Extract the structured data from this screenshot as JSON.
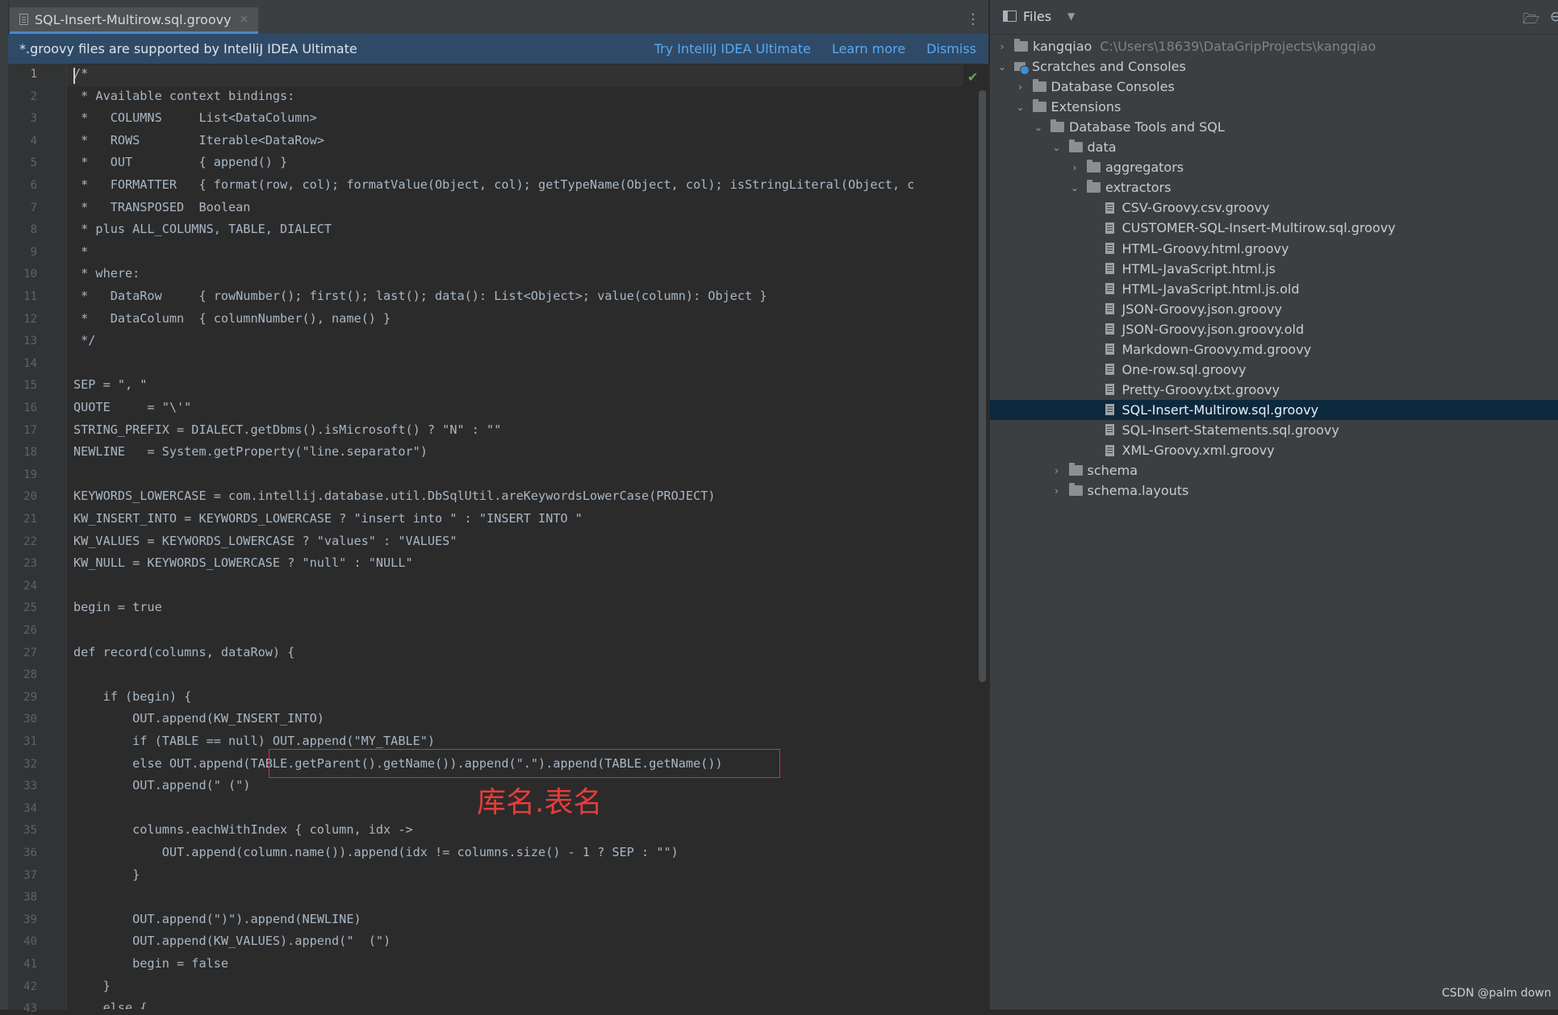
{
  "tab": {
    "label": "SQL-Insert-Multirow.sql.groovy",
    "close_glyph": "×"
  },
  "banner": {
    "message": "*.groovy files are supported by IntelliJ IDEA Ultimate",
    "try_link": "Try IntelliJ IDEA Ultimate",
    "learn_link": "Learn more",
    "dismiss_link": "Dismiss"
  },
  "editor": {
    "current_line": 1,
    "lines": [
      "/*",
      " * Available context bindings:",
      " *   COLUMNS     List<DataColumn>",
      " *   ROWS        Iterable<DataRow>",
      " *   OUT         { append() }",
      " *   FORMATTER   { format(row, col); formatValue(Object, col); getTypeName(Object, col); isStringLiteral(Object, c",
      " *   TRANSPOSED  Boolean",
      " * plus ALL_COLUMNS, TABLE, DIALECT",
      " *",
      " * where:",
      " *   DataRow     { rowNumber(); first(); last(); data(): List<Object>; value(column): Object }",
      " *   DataColumn  { columnNumber(), name() }",
      " */",
      "",
      "SEP = \", \"",
      "QUOTE     = \"\\'\"",
      "STRING_PREFIX = DIALECT.getDbms().isMicrosoft() ? \"N\" : \"\"",
      "NEWLINE   = System.getProperty(\"line.separator\")",
      "",
      "KEYWORDS_LOWERCASE = com.intellij.database.util.DbSqlUtil.areKeywordsLowerCase(PROJECT)",
      "KW_INSERT_INTO = KEYWORDS_LOWERCASE ? \"insert into \" : \"INSERT INTO \"",
      "KW_VALUES = KEYWORDS_LOWERCASE ? \"values\" : \"VALUES\"",
      "KW_NULL = KEYWORDS_LOWERCASE ? \"null\" : \"NULL\"",
      "",
      "begin = true",
      "",
      "def record(columns, dataRow) {",
      "",
      "    if (begin) {",
      "        OUT.append(KW_INSERT_INTO)",
      "        if (TABLE == null) OUT.append(\"MY_TABLE\")",
      "        else OUT.append(TABLE.getParent().getName()).append(\".\").append(TABLE.getName())",
      "        OUT.append(\" (\")",
      "",
      "        columns.eachWithIndex { column, idx ->",
      "            OUT.append(column.name()).append(idx != columns.size() - 1 ? SEP : \"\")",
      "        }",
      "",
      "        OUT.append(\")\").append(NEWLINE)",
      "        OUT.append(KW_VALUES).append(\"  (\")",
      "        begin = false",
      "    }",
      "    else {"
    ],
    "line_numbers": [
      "1",
      "2",
      "3",
      "4",
      "5",
      "6",
      "7",
      "8",
      "9",
      "10",
      "11",
      "12",
      "13",
      "14",
      "15",
      "16",
      "17",
      "18",
      "19",
      "20",
      "21",
      "22",
      "23",
      "24",
      "25",
      "26",
      "27",
      "28",
      "29",
      "30",
      "31",
      "32",
      "33",
      "34",
      "35",
      "36",
      "37",
      "38",
      "39",
      "40",
      "41",
      "42",
      "43"
    ]
  },
  "annotation": {
    "text": "库名.表名",
    "color": "#e83b3b"
  },
  "project": {
    "header_title": "Files",
    "tree": [
      {
        "depth": 0,
        "arrow": "›",
        "kind": "folder",
        "label": "kangqiao",
        "path": "C:\\Users\\18639\\DataGripProjects\\kangqiao"
      },
      {
        "depth": 0,
        "arrow": "⌄",
        "kind": "scratch",
        "label": "Scratches and Consoles"
      },
      {
        "depth": 1,
        "arrow": "›",
        "kind": "folder",
        "label": "Database Consoles"
      },
      {
        "depth": 1,
        "arrow": "⌄",
        "kind": "folder",
        "label": "Extensions"
      },
      {
        "depth": 2,
        "arrow": "⌄",
        "kind": "folder",
        "label": "Database Tools and SQL"
      },
      {
        "depth": 3,
        "arrow": "⌄",
        "kind": "folder",
        "label": "data"
      },
      {
        "depth": 4,
        "arrow": "›",
        "kind": "folder",
        "label": "aggregators"
      },
      {
        "depth": 4,
        "arrow": "⌄",
        "kind": "folder",
        "label": "extractors"
      },
      {
        "depth": 5,
        "arrow": "",
        "kind": "file",
        "label": "CSV-Groovy.csv.groovy"
      },
      {
        "depth": 5,
        "arrow": "",
        "kind": "file",
        "label": "CUSTOMER-SQL-Insert-Multirow.sql.groovy"
      },
      {
        "depth": 5,
        "arrow": "",
        "kind": "file",
        "label": "HTML-Groovy.html.groovy"
      },
      {
        "depth": 5,
        "arrow": "",
        "kind": "file",
        "label": "HTML-JavaScript.html.js"
      },
      {
        "depth": 5,
        "arrow": "",
        "kind": "file",
        "label": "HTML-JavaScript.html.js.old"
      },
      {
        "depth": 5,
        "arrow": "",
        "kind": "file",
        "label": "JSON-Groovy.json.groovy"
      },
      {
        "depth": 5,
        "arrow": "",
        "kind": "file",
        "label": "JSON-Groovy.json.groovy.old"
      },
      {
        "depth": 5,
        "arrow": "",
        "kind": "file",
        "label": "Markdown-Groovy.md.groovy"
      },
      {
        "depth": 5,
        "arrow": "",
        "kind": "file",
        "label": "One-row.sql.groovy"
      },
      {
        "depth": 5,
        "arrow": "",
        "kind": "file",
        "label": "Pretty-Groovy.txt.groovy"
      },
      {
        "depth": 5,
        "arrow": "",
        "kind": "file",
        "label": "SQL-Insert-Multirow.sql.groovy",
        "selected": true
      },
      {
        "depth": 5,
        "arrow": "",
        "kind": "file",
        "label": "SQL-Insert-Statements.sql.groovy"
      },
      {
        "depth": 5,
        "arrow": "",
        "kind": "file",
        "label": "XML-Groovy.xml.groovy"
      },
      {
        "depth": 3,
        "arrow": "›",
        "kind": "folder",
        "label": "schema"
      },
      {
        "depth": 3,
        "arrow": "›",
        "kind": "folder",
        "label": "schema.layouts"
      }
    ]
  },
  "watermark": "CSDN @palm down",
  "colors": {
    "accent": "#4a88c7",
    "banner_bg": "#2f4a67",
    "link": "#59a9f2",
    "selection": "#0d293e"
  },
  "icons": [
    "file-icon",
    "close-icon",
    "kebab-icon",
    "check-icon",
    "files-icon",
    "chevron-down-icon",
    "folder-open-icon",
    "folder-icon",
    "scratch-icon"
  ]
}
